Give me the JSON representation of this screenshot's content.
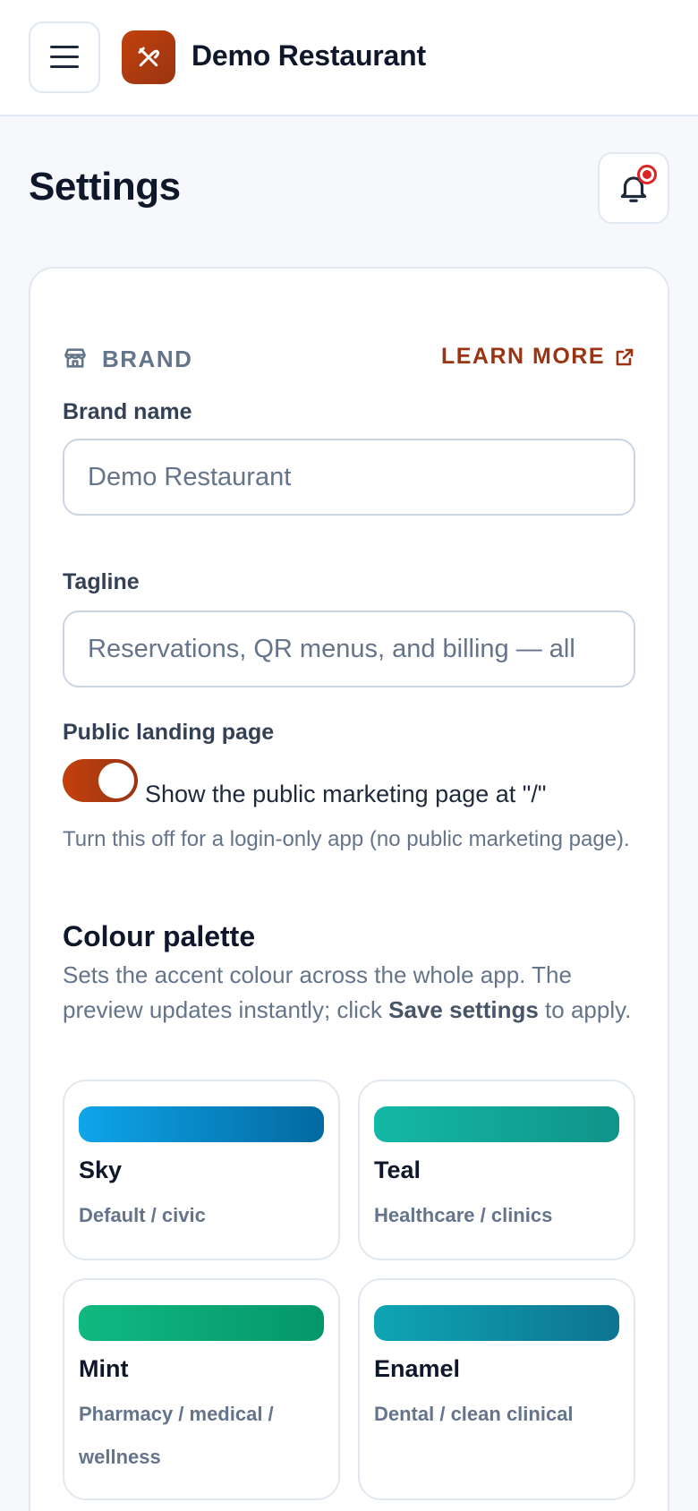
{
  "app": {
    "title": "Demo Restaurant",
    "logo_icon": "fork-knife-icon",
    "brand_gradient": [
      "#c2410c",
      "#9a3412"
    ]
  },
  "page": {
    "title": "Settings"
  },
  "brand_section": {
    "label": "BRAND",
    "learn_more": "LEARN MORE",
    "brand_name": {
      "label": "Brand name",
      "value": "Demo Restaurant"
    },
    "tagline": {
      "label": "Tagline",
      "value": "Reservations, QR menus, and billing — all"
    },
    "landing": {
      "label": "Public landing page",
      "toggle_on": true,
      "toggle_text": "Show the public marketing page at \"/\"",
      "helper": "Turn this off for a login-only app (no public marketing page)."
    }
  },
  "palette": {
    "title": "Colour palette",
    "desc_prefix": "Sets the accent colour across the whole app. The preview updates instantly; click ",
    "desc_bold": "Save settings",
    "desc_suffix": " to apply.",
    "options": [
      {
        "name": "Sky",
        "sub": "Default / civic",
        "color_from": "#0ea5e9",
        "color_to": "#0369a1"
      },
      {
        "name": "Teal",
        "sub": "Healthcare / clinics",
        "color_from": "#14b8a6",
        "color_to": "#0f9488"
      },
      {
        "name": "Mint",
        "sub": "Pharmacy / medical / wellness",
        "color_from": "#10b981",
        "color_to": "#059669"
      },
      {
        "name": "Enamel",
        "sub": "Dental / clean clinical",
        "color_from": "#0ea5b4",
        "color_to": "#0e7490"
      }
    ]
  }
}
